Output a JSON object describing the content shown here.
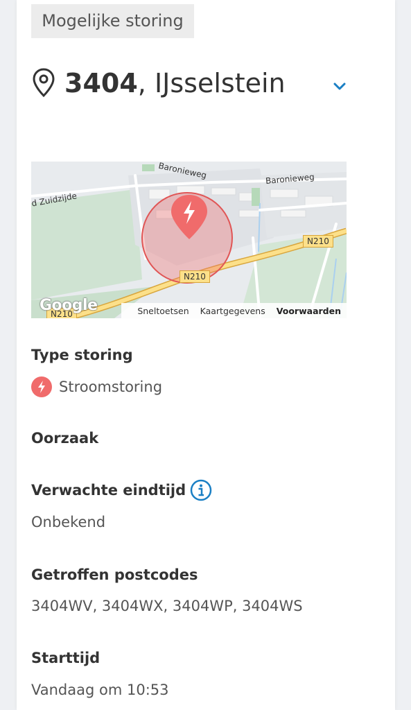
{
  "tag": "Mogelijke storing",
  "location": {
    "postal": "3404",
    "separator": ",",
    "city": "IJsselstein"
  },
  "map": {
    "labels": {
      "road1": "Baronieweg",
      "road2": "Baronieweg",
      "road3": "Zuidzijde",
      "n210_a": "N210",
      "n210_b": "N210",
      "n210_c": "N210"
    },
    "logo": "Google",
    "footer": {
      "shortcuts": "Sneltoetsen",
      "mapdata": "Kaartgegevens",
      "terms": "Voorwaarden"
    }
  },
  "details": {
    "type_label": "Type storing",
    "type_value": "Stroomstoring",
    "cause_label": "Oorzaak",
    "end_label": "Verwachte eindtijd",
    "end_value": "Onbekend",
    "postcodes_label": "Getroffen postcodes",
    "postcodes_value": "3404WV, 3404WX, 3404WP, 3404WS",
    "start_label": "Starttijd",
    "start_value": "Vandaag om 10:53"
  },
  "colors": {
    "accent": "#1a7fc4",
    "outage_red": "#f06b6b",
    "highway_yellow": "#fce08a"
  },
  "icons": {
    "location": "map-pin-icon",
    "expand": "chevron-down-icon",
    "type": "lightning-bolt-icon",
    "info": "info-icon"
  }
}
